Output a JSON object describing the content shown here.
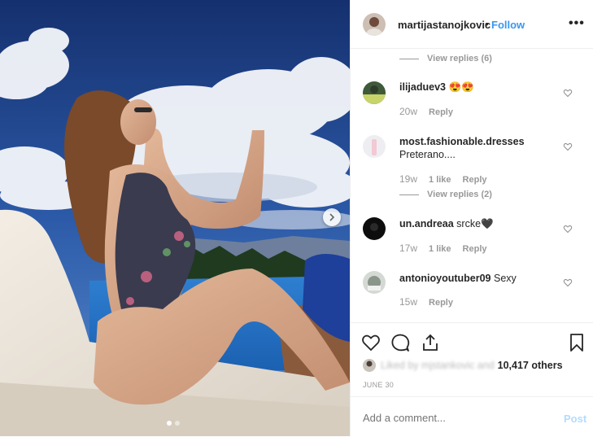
{
  "post": {
    "username": "martijastanojkovic",
    "separator": "•",
    "follow_label": "Follow",
    "more_label": "•••"
  },
  "comments": [
    {
      "type": "view_replies",
      "label": "View replies (6)"
    },
    {
      "type": "comment",
      "username": "ilijaduev3",
      "text": "😍😍",
      "time": "20w",
      "likes": "",
      "reply_label": "Reply"
    },
    {
      "type": "comment",
      "username": "most.fashionable.dresses",
      "text": "Preterano....",
      "time": "19w",
      "likes": "1 like",
      "reply_label": "Reply"
    },
    {
      "type": "view_replies",
      "label": "View replies (2)"
    },
    {
      "type": "comment",
      "username": "un.andreaa",
      "text": "srcke🖤",
      "time": "17w",
      "likes": "1 like",
      "reply_label": "Reply"
    },
    {
      "type": "comment",
      "username": "antonioyoutuber09",
      "text": "Sexy",
      "time": "15w",
      "likes": "",
      "reply_label": "Reply"
    }
  ],
  "actions": {
    "liked_by_prefix": "Liked by ",
    "liked_by_blurred": "mjstankovic and",
    "likes_count": "10,417 others",
    "date": "JUNE 30"
  },
  "add_comment": {
    "placeholder": "Add a comment...",
    "post_label": "Post"
  },
  "icons": {
    "next": "chevron-right-icon",
    "like": "heart-icon",
    "comment": "comment-bubble-icon",
    "share": "share-icon",
    "save": "bookmark-icon"
  },
  "colors": {
    "follow": "#3897f0",
    "post_disabled": "#b3dbff",
    "secondary_text": "#999999",
    "primary_text": "#262626"
  },
  "carousel": {
    "current": 1,
    "total": 2
  }
}
